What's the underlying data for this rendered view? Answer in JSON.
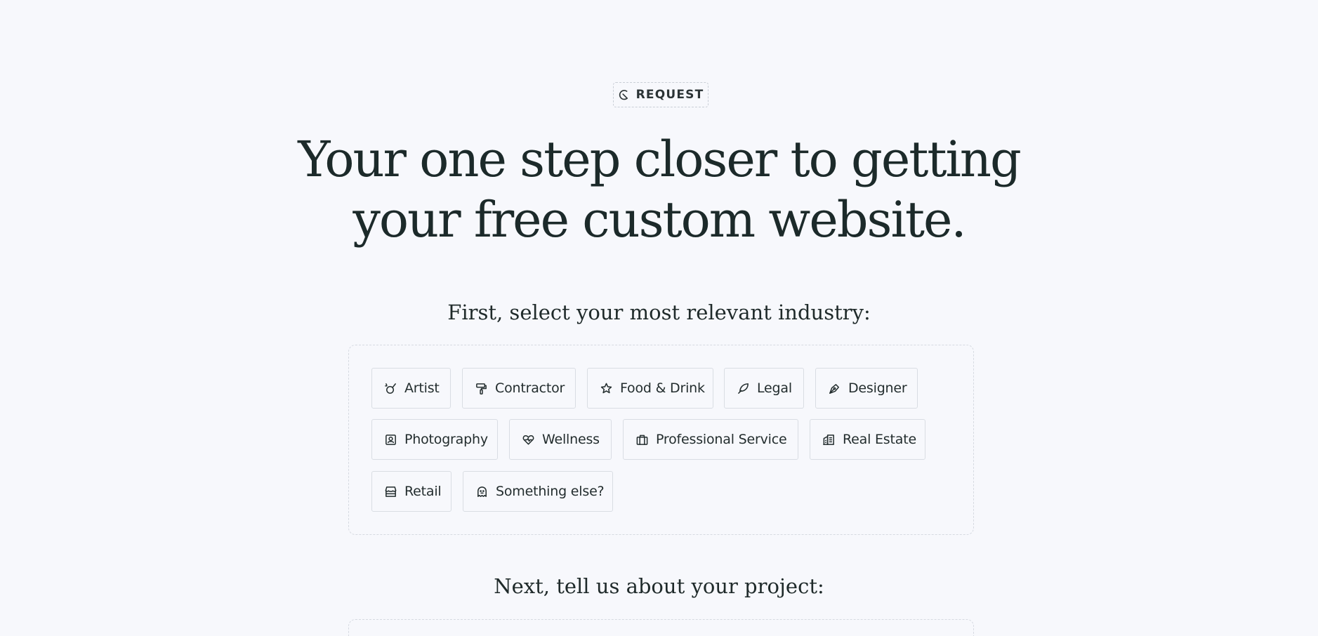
{
  "badge": {
    "label": "REQUEST",
    "icon": "moon-mark-icon"
  },
  "headline": {
    "line1": "Your one step closer to getting",
    "line2": "your free custom website."
  },
  "industry_section": {
    "title": "First, select your most relevant industry:",
    "chips": [
      {
        "label": "Artist",
        "icon": "brush-icon"
      },
      {
        "label": "Contractor",
        "icon": "paint-roller-icon"
      },
      {
        "label": "Food & Drink",
        "icon": "star-dish-icon"
      },
      {
        "label": "Legal",
        "icon": "quill-icon"
      },
      {
        "label": "Designer",
        "icon": "pen-nib-icon"
      },
      {
        "label": "Photography",
        "icon": "portrait-icon"
      },
      {
        "label": "Wellness",
        "icon": "heart-pulse-icon"
      },
      {
        "label": "Professional Service",
        "icon": "briefcase-icon"
      },
      {
        "label": "Real Estate",
        "icon": "buildings-icon"
      },
      {
        "label": "Retail",
        "icon": "storefront-icon"
      },
      {
        "label": "Something else?",
        "icon": "ghost-icon"
      }
    ]
  },
  "project_section": {
    "title": "Next, tell us about your project:"
  },
  "colors": {
    "background": "#f7f8fc",
    "text": "#1c2a2a",
    "border": "#d9dde3"
  }
}
